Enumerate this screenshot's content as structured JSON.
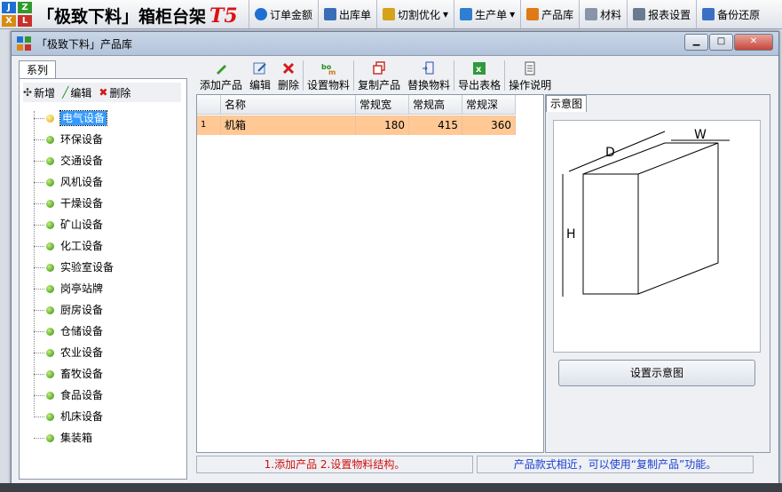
{
  "app": {
    "title_prefix": "「极致下料」箱柜台架",
    "title_version": "T5",
    "logo_letters": [
      "J",
      "Z",
      "X",
      "L"
    ]
  },
  "topmenu": [
    {
      "label": "订单金额",
      "icon": "order-amount-icon",
      "color": "#1f6fd1"
    },
    {
      "label": "出库单",
      "icon": "truck-icon",
      "color": "#3a6fb8"
    },
    {
      "label": "切割优化",
      "icon": "cut-optimize-icon",
      "color": "#d6a21a",
      "dropdown": "▾"
    },
    {
      "label": "生产单",
      "icon": "production-icon",
      "color": "#2e7fd0",
      "dropdown": "▾"
    },
    {
      "label": "产品库",
      "icon": "product-library-icon",
      "color": "#e07a16"
    },
    {
      "label": "材料",
      "icon": "material-icon",
      "color": "#8894a8"
    },
    {
      "label": "报表设置",
      "icon": "report-icon",
      "color": "#6a7a90"
    },
    {
      "label": "备份还原",
      "icon": "backup-icon",
      "color": "#3b6fc4"
    }
  ],
  "window": {
    "title": "「极致下料」产品库",
    "min": "▁",
    "max": "□",
    "close": "✕"
  },
  "left": {
    "tab_label": "系列",
    "tools": {
      "add": "新增",
      "edit": "编辑",
      "delete": "删除"
    },
    "tree": [
      "电气设备",
      "环保设备",
      "交通设备",
      "风机设备",
      "干燥设备",
      "矿山设备",
      "化工设备",
      "实验室设备",
      "岗亭站牌",
      "厨房设备",
      "仓储设备",
      "农业设备",
      "畜牧设备",
      "食品设备",
      "机床设备",
      "集装箱"
    ],
    "selected_index": 0
  },
  "toolbar": {
    "add_product": "添加产品",
    "edit": "编辑",
    "delete": "删除",
    "set_material": "设置物料",
    "copy_product": "复制产品",
    "replace_material": "替换物料",
    "export_table": "导出表格",
    "help": "操作说明"
  },
  "grid": {
    "headers": [
      "名称",
      "常规宽",
      "常规高",
      "常规深"
    ],
    "rows": [
      {
        "index": "1",
        "name": "机箱",
        "width": "180",
        "height": "415",
        "depth": "360"
      }
    ]
  },
  "preview": {
    "tab_label": "示意图",
    "labels": {
      "d": "D",
      "w": "W",
      "h": "H"
    },
    "button": "设置示意图"
  },
  "status": {
    "left": "1.添加产品 2.设置物料结构。",
    "right": "产品款式相近，可以使用“复制产品”功能。",
    "left_color": "#d01010",
    "right_color": "#1a3fd0"
  }
}
